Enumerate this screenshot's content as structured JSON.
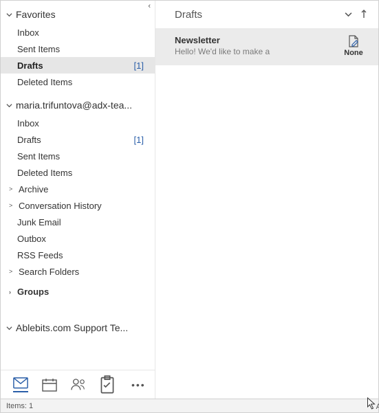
{
  "nav": {
    "favorites": {
      "title": "Favorites",
      "items": [
        {
          "label": "Inbox",
          "count": "",
          "selected": false
        },
        {
          "label": "Sent Items",
          "count": "",
          "selected": false
        },
        {
          "label": "Drafts",
          "count": "[1]",
          "selected": true
        },
        {
          "label": "Deleted Items",
          "count": "",
          "selected": false
        }
      ]
    },
    "account": {
      "title": "maria.trifuntova@adx-tea...",
      "items": [
        {
          "label": "Inbox",
          "count": "",
          "expand": ""
        },
        {
          "label": "Drafts",
          "count": "[1]",
          "expand": ""
        },
        {
          "label": "Sent Items",
          "count": "",
          "expand": ""
        },
        {
          "label": "Deleted Items",
          "count": "",
          "expand": ""
        },
        {
          "label": "Archive",
          "count": "",
          "expand": ">"
        },
        {
          "label": "Conversation History",
          "count": "",
          "expand": ">"
        },
        {
          "label": "Junk Email",
          "count": "",
          "expand": ""
        },
        {
          "label": "Outbox",
          "count": "",
          "expand": ""
        },
        {
          "label": "RSS Feeds",
          "count": "",
          "expand": ""
        },
        {
          "label": "Search Folders",
          "count": "",
          "expand": ">"
        }
      ],
      "groups": "Groups"
    },
    "second_account": {
      "title": "Ablebits.com Support Te..."
    }
  },
  "content": {
    "header": "Drafts",
    "messages": [
      {
        "subject": "Newsletter",
        "preview": "Hello!  We'd like to make a",
        "category": "None"
      }
    ]
  },
  "status": {
    "text": "Items: 1"
  }
}
